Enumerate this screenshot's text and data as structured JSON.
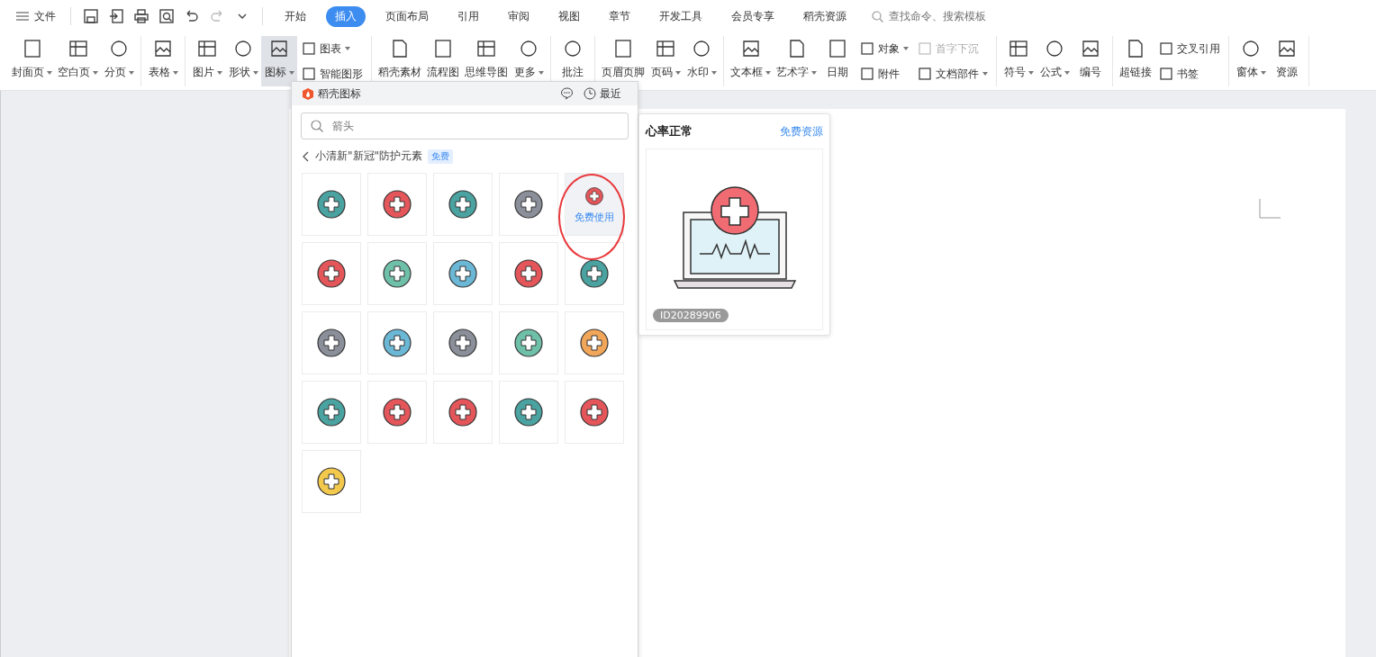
{
  "menu": {
    "label": "文件"
  },
  "quick_access": [
    {
      "kind": "save",
      "disabled": false
    },
    {
      "kind": "export",
      "disabled": false
    },
    {
      "kind": "print",
      "disabled": false
    },
    {
      "kind": "preview",
      "disabled": false
    },
    {
      "kind": "undo",
      "disabled": false
    },
    {
      "kind": "redo",
      "disabled": true
    },
    {
      "kind": "customize",
      "disabled": false
    }
  ],
  "tabs": [
    {
      "label": "开始",
      "selected": false
    },
    {
      "label": "插入",
      "selected": true
    },
    {
      "label": "页面布局",
      "selected": false
    },
    {
      "label": "引用",
      "selected": false
    },
    {
      "label": "审阅",
      "selected": false
    },
    {
      "label": "视图",
      "selected": false
    },
    {
      "label": "章节",
      "selected": false
    },
    {
      "label": "开发工具",
      "selected": false
    },
    {
      "label": "会员专享",
      "selected": false
    },
    {
      "label": "稻壳资源",
      "selected": false
    }
  ],
  "search": {
    "placeholder": "查找命令、搜索模板"
  },
  "ribbon": [
    [
      {
        "kind": "big",
        "label": "封面页",
        "dropdown": true,
        "selected": false
      },
      {
        "kind": "big",
        "label": "空白页",
        "dropdown": true,
        "selected": false
      },
      {
        "kind": "big",
        "label": "分页",
        "dropdown": true,
        "selected": false
      }
    ],
    [
      {
        "kind": "big",
        "label": "表格",
        "dropdown": true,
        "selected": false
      }
    ],
    [
      {
        "kind": "big",
        "label": "图片",
        "dropdown": true,
        "selected": false
      },
      {
        "kind": "big",
        "label": "形状",
        "dropdown": true,
        "selected": false
      },
      {
        "kind": "big",
        "label": "图标",
        "dropdown": true,
        "selected": true
      },
      {
        "kind": "pair",
        "items": [
          {
            "label": "图表",
            "dropdown": true,
            "disabled": false
          },
          {
            "label": "智能图形",
            "dropdown": false,
            "disabled": false
          }
        ]
      }
    ],
    [
      {
        "kind": "big",
        "label": "稻壳素材",
        "dropdown": false,
        "selected": false
      },
      {
        "kind": "big",
        "label": "流程图",
        "dropdown": false,
        "selected": false
      },
      {
        "kind": "big",
        "label": "思维导图",
        "dropdown": false,
        "selected": false
      },
      {
        "kind": "big",
        "label": "更多",
        "dropdown": true,
        "selected": false
      }
    ],
    [
      {
        "kind": "big",
        "label": "批注",
        "dropdown": false,
        "selected": false
      }
    ],
    [
      {
        "kind": "big",
        "label": "页眉页脚",
        "dropdown": false,
        "selected": false
      },
      {
        "kind": "big",
        "label": "页码",
        "dropdown": true,
        "selected": false
      },
      {
        "kind": "big",
        "label": "水印",
        "dropdown": true,
        "selected": false
      }
    ],
    [
      {
        "kind": "big",
        "label": "文本框",
        "dropdown": true,
        "selected": false
      },
      {
        "kind": "big",
        "label": "艺术字",
        "dropdown": true,
        "selected": false
      },
      {
        "kind": "big",
        "label": "日期",
        "dropdown": false,
        "selected": false
      },
      {
        "kind": "pair",
        "items": [
          {
            "label": "对象",
            "dropdown": true,
            "disabled": false
          },
          {
            "label": "附件",
            "dropdown": false,
            "disabled": false
          }
        ]
      },
      {
        "kind": "pair",
        "items": [
          {
            "label": "首字下沉",
            "dropdown": false,
            "disabled": true
          },
          {
            "label": "文档部件",
            "dropdown": true,
            "disabled": false
          }
        ]
      }
    ],
    [
      {
        "kind": "big",
        "label": "符号",
        "dropdown": true,
        "selected": false
      },
      {
        "kind": "big",
        "label": "公式",
        "dropdown": true,
        "selected": false
      },
      {
        "kind": "big",
        "label": "编号",
        "dropdown": false,
        "selected": false
      }
    ],
    [
      {
        "kind": "big",
        "label": "超链接",
        "dropdown": false,
        "selected": false
      },
      {
        "kind": "pair",
        "items": [
          {
            "label": "交叉引用",
            "dropdown": false,
            "disabled": false
          },
          {
            "label": "书签",
            "dropdown": false,
            "disabled": false
          }
        ]
      }
    ],
    [
      {
        "kind": "big",
        "label": "窗体",
        "dropdown": true,
        "selected": false
      },
      {
        "kind": "big",
        "label": "资源",
        "dropdown": false,
        "selected": false
      }
    ]
  ],
  "icon_panel": {
    "title": "稻壳图标",
    "recent": "最近",
    "search_placeholder": "箭头",
    "category": "小清新\"新冠\"防护元素",
    "category_badge": "免费",
    "icons": [
      {
        "color": "#4aa3a0",
        "hovered": false
      },
      {
        "color": "#e5565b",
        "hovered": false
      },
      {
        "color": "#4aa3a0",
        "hovered": false
      },
      {
        "color": "#8a8f99",
        "hovered": false
      },
      {
        "color": "#e5565b",
        "hovered": true,
        "hover_label": "免费使用"
      },
      {
        "color": "#e5565b",
        "hovered": false
      },
      {
        "color": "#6fc0a8",
        "hovered": false
      },
      {
        "color": "#6bb8d6",
        "hovered": false
      },
      {
        "color": "#e5565b",
        "hovered": false
      },
      {
        "color": "#4aa3a0",
        "hovered": false
      },
      {
        "color": "#8a8f99",
        "hovered": false
      },
      {
        "color": "#6bb8d6",
        "hovered": false
      },
      {
        "color": "#8a8f99",
        "hovered": false
      },
      {
        "color": "#6fc0a8",
        "hovered": false
      },
      {
        "color": "#f2a65a",
        "hovered": false
      },
      {
        "color": "#4aa3a0",
        "hovered": false
      },
      {
        "color": "#e5565b",
        "hovered": false
      },
      {
        "color": "#e5565b",
        "hovered": false
      },
      {
        "color": "#4aa3a0",
        "hovered": false
      },
      {
        "color": "#e5565b",
        "hovered": false
      },
      {
        "color": "#f2c94c",
        "hovered": false
      }
    ]
  },
  "preview": {
    "title": "心率正常",
    "link": "免费资源",
    "id_badge": "ID20289906"
  }
}
